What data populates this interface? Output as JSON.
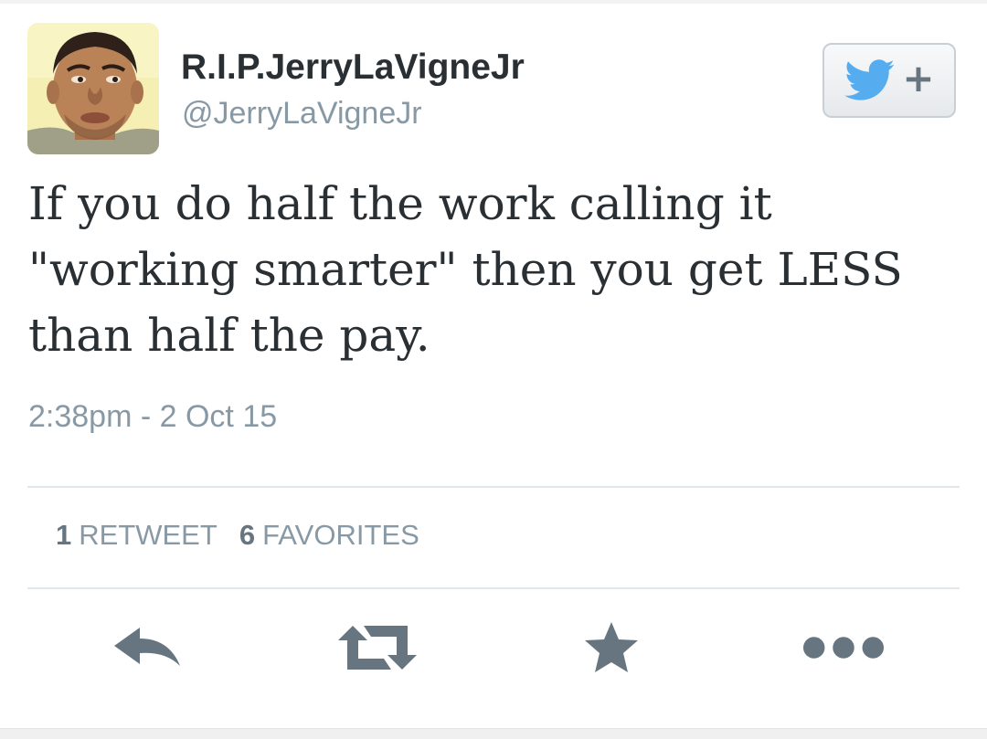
{
  "user": {
    "display_name": "R.I.P.JerryLaVigneJr",
    "handle": "@JerryLaVigneJr"
  },
  "tweet": {
    "text": "If you do half the work calling it\n\"working smarter\" then you get LESS\nthan half the pay.",
    "timestamp": "2:38pm - 2 Oct 15"
  },
  "stats": {
    "retweets_count": "1",
    "retweets_label": "RETWEET",
    "favorites_count": "6",
    "favorites_label": "FAVORITES"
  },
  "icons": {
    "follow": "twitter-bird-plus-icon",
    "reply": "reply-icon",
    "retweet": "retweet-icon",
    "favorite": "star-icon",
    "more": "more-dots-icon"
  },
  "colors": {
    "twitter_blue": "#55acee",
    "text": "#292f33",
    "secondary_text": "#8899a6",
    "icon_gray": "#66757f"
  }
}
